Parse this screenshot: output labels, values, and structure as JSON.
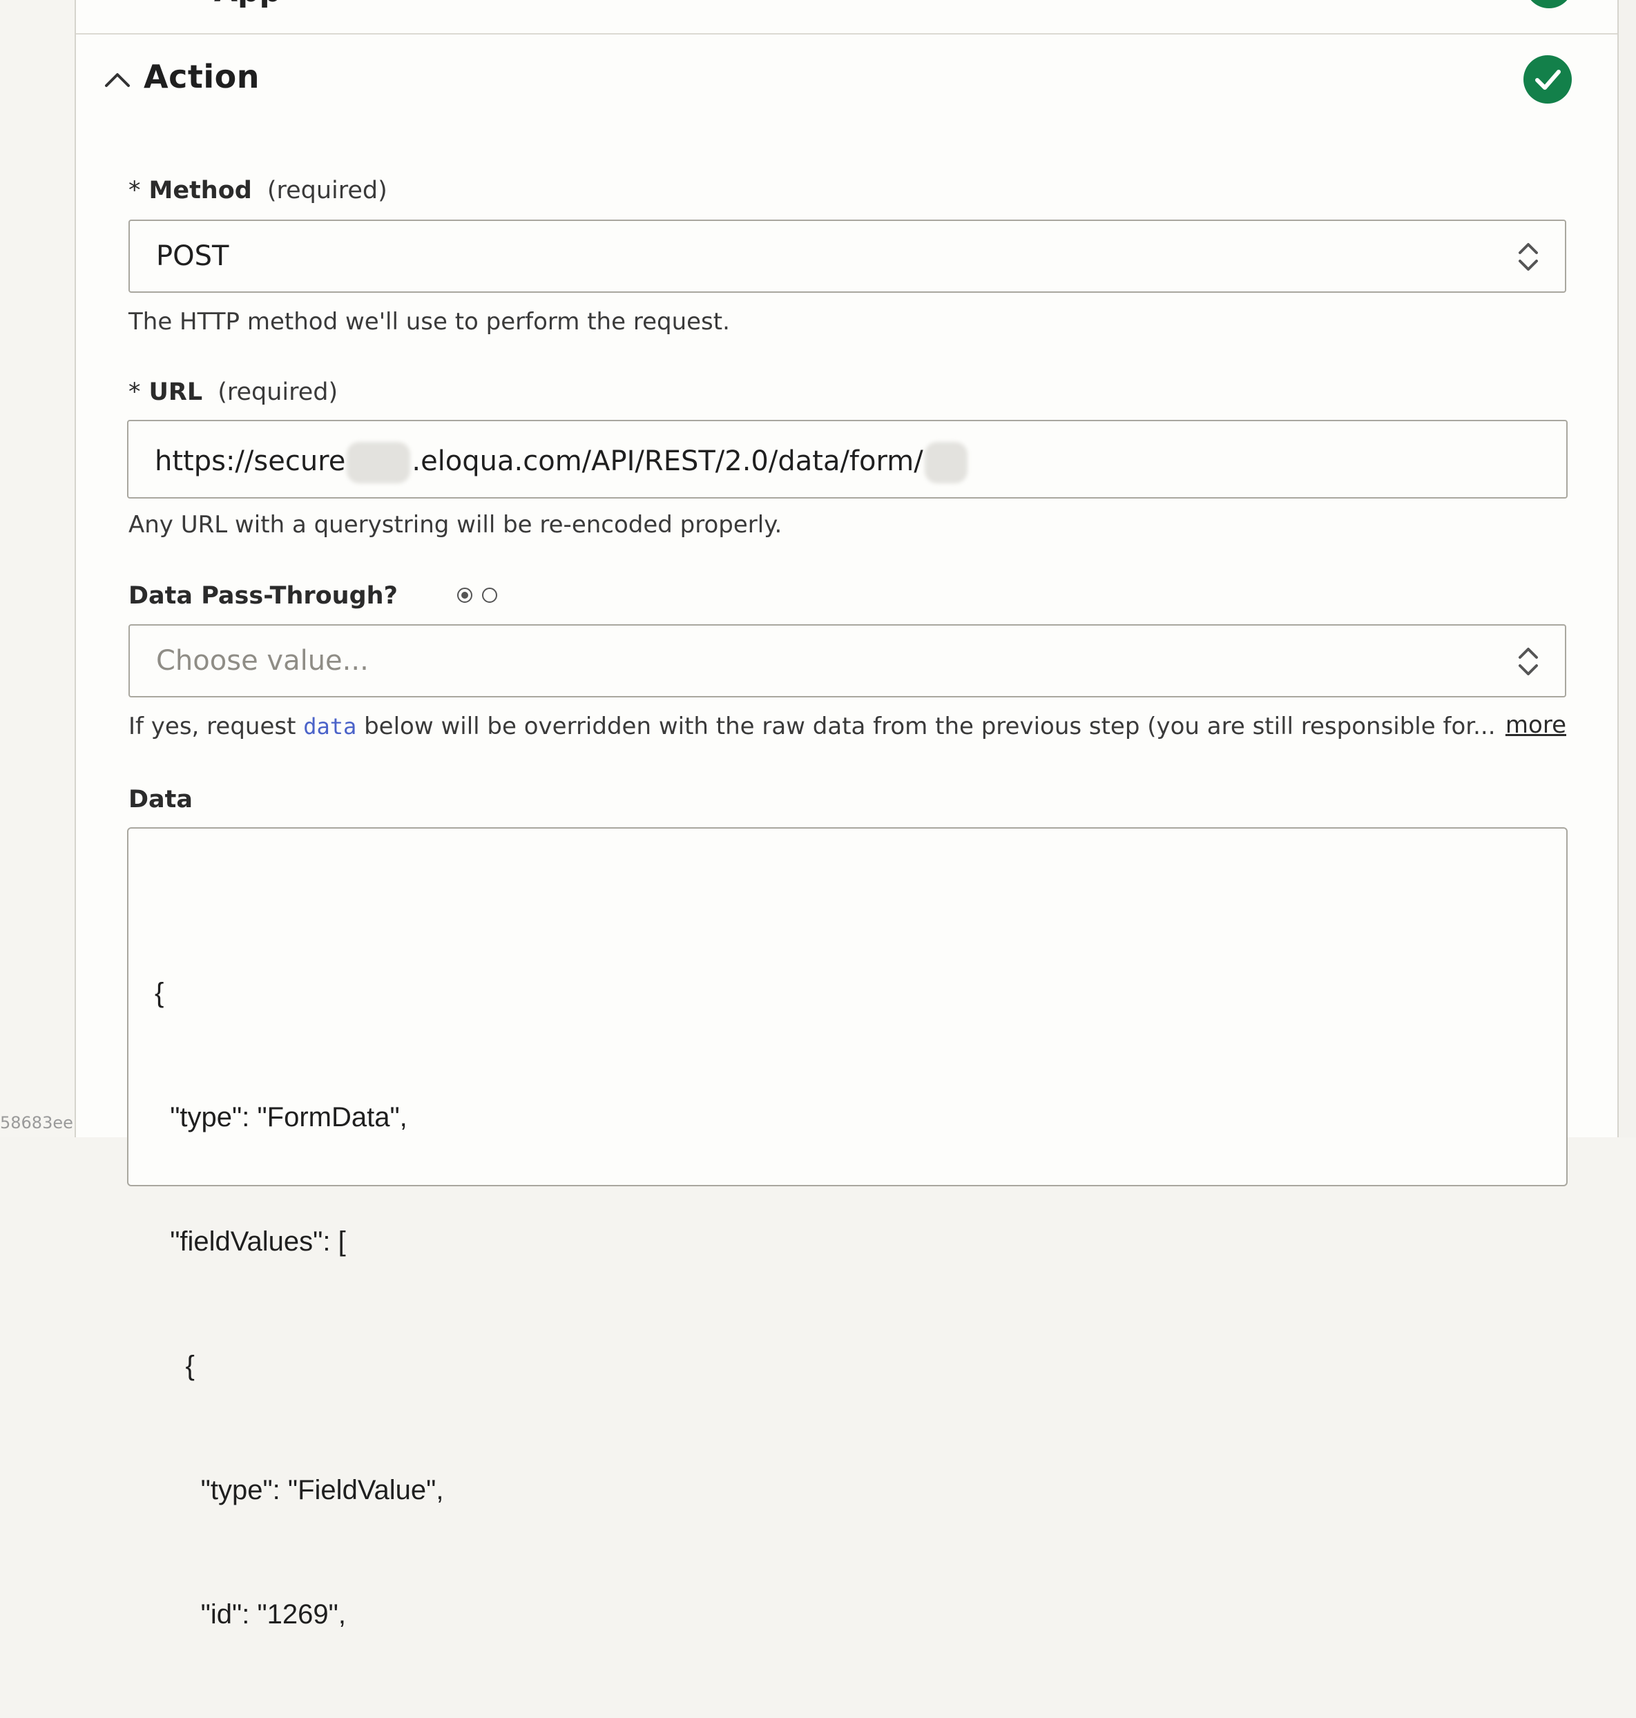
{
  "sidebar_id_fragment": "58683ee",
  "section": {
    "title": "Action",
    "status": "complete",
    "status_color": "#13804a"
  },
  "method_field": {
    "required_marker": "*",
    "label": "Method",
    "required_text": "(required)",
    "value": "POST",
    "help": "The HTTP method we'll use to perform the request."
  },
  "url_field": {
    "required_marker": "*",
    "label": "URL",
    "value_part1": "https://secure",
    "value_part2": ".eloqua.com/API/REST/2.0/data/form/",
    "help": "Any URL with a querystring will be re-encoded properly."
  },
  "passthrough_field": {
    "label": "Data Pass-Through?",
    "placeholder": "Choose value...",
    "help_before": "If yes, request ",
    "help_code": "data",
    "help_after": " below will be overridden with the raw data from the previous step (you are still responsible for...",
    "more_link": "more"
  },
  "data_field": {
    "label": "Data",
    "lines": [
      "{",
      "  \"type\": \"FormData\",",
      "  \"fieldValues\": [",
      "    {",
      "      \"type\": \"FieldValue\",",
      "      \"id\": \"1269\","
    ]
  },
  "colors": {
    "accent_green": "#13804a",
    "code_blue": "#4b63c9"
  }
}
